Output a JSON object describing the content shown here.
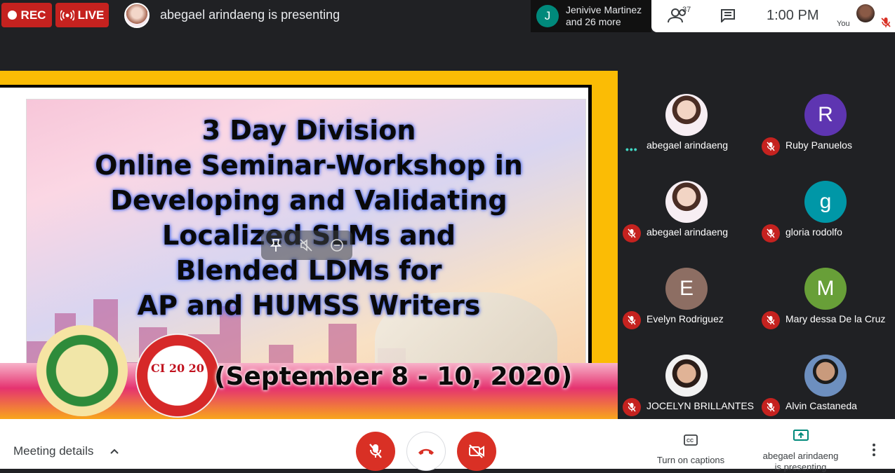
{
  "topbar": {
    "rec_label": "REC",
    "live_label": "LIVE",
    "presenting_text": "abegael arindaeng is presenting",
    "joiner_initial": "J",
    "joiner_name": "Jenivive Martinez",
    "joiner_more": "and 26 more",
    "people_count": "37",
    "time": "1:00 PM",
    "you_label": "You"
  },
  "slide": {
    "title_lines": [
      "3 Day Division",
      "Online Seminar-Workshop in",
      "Developing and Validating",
      "Localized SLMs and",
      "Blended LDMs for",
      "AP and HUMSS Writers"
    ],
    "date": "(September 8 - 10, 2020)",
    "seal2_text": "CI 20 20"
  },
  "participants": [
    {
      "name": "abegael arindaeng",
      "initial": "",
      "color": "",
      "photo": true,
      "muted": false
    },
    {
      "name": "Ruby Panuelos",
      "initial": "R",
      "color": "#5e35b1",
      "photo": false,
      "muted": true
    },
    {
      "name": "abegael arindaeng",
      "initial": "",
      "color": "",
      "photo": true,
      "muted": true
    },
    {
      "name": "gloria rodolfo",
      "initial": "g",
      "color": "#0097a7",
      "photo": false,
      "muted": true
    },
    {
      "name": "Evelyn Rodriguez",
      "initial": "E",
      "color": "#8d6e63",
      "photo": false,
      "muted": true
    },
    {
      "name": "Mary dessa De la Cruz",
      "initial": "M",
      "color": "#689f38",
      "photo": false,
      "muted": true
    },
    {
      "name": "JOCELYN BRILLANTES",
      "initial": "",
      "color": "",
      "photo": true,
      "muted": true
    },
    {
      "name": "Alvin Castaneda",
      "initial": "",
      "color": "",
      "photo": true,
      "muted": true
    }
  ],
  "bottombar": {
    "meeting_details": "Meeting details",
    "captions_label": "Turn on captions",
    "presenting_label_1": "abegael arindaeng",
    "presenting_label_2": "is presenting"
  },
  "colors": {
    "accent_red": "#d93025",
    "slide_border": "#fbbc05",
    "background": "#202124"
  }
}
